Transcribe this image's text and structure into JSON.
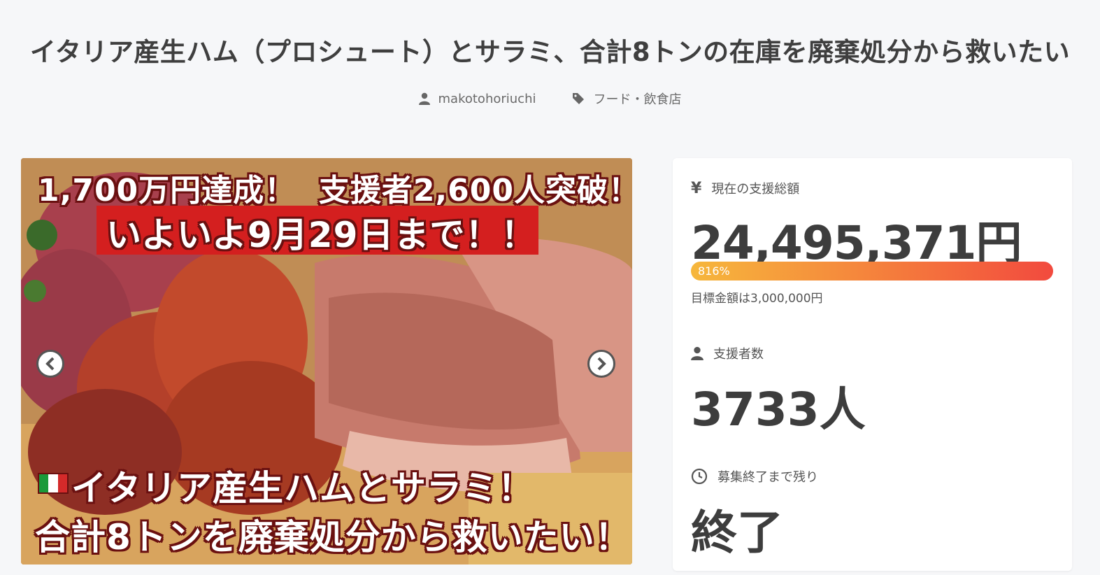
{
  "project": {
    "title": "イタリア産生ハム（プロシュート）とサラミ、合計8トンの在庫を廃棄処分から救いたい",
    "author": "makotohoriuchi",
    "category": "フード・飲食店"
  },
  "hero": {
    "caption_top_part1": "1,700万円達成！",
    "caption_top_part2": "支援者2,600人突破！",
    "caption_red": "いよいよ9月29日まで！！",
    "caption_bottom1": "イタリア産生ハムとサラミ！",
    "caption_bottom2": "合計8トンを廃棄処分から救いたい！",
    "flag_colors": [
      "#1a9a3a",
      "#ffffff",
      "#d42a2a"
    ]
  },
  "stats": {
    "amount_icon": "¥",
    "amount_label": "現在の支援総額",
    "amount": "24,495,371円",
    "progress_label": "816%",
    "progress_fraction": 1.0,
    "goal": "目標金額は3,000,000円",
    "backers_label": "支援者数",
    "backers": "3733人",
    "remaining_label": "募集終了まで残り",
    "remaining": "終了"
  },
  "colors": {
    "progress_start": "#f6b73c",
    "progress_end": "#f24a3e",
    "caption_red": "#d41f1f"
  }
}
